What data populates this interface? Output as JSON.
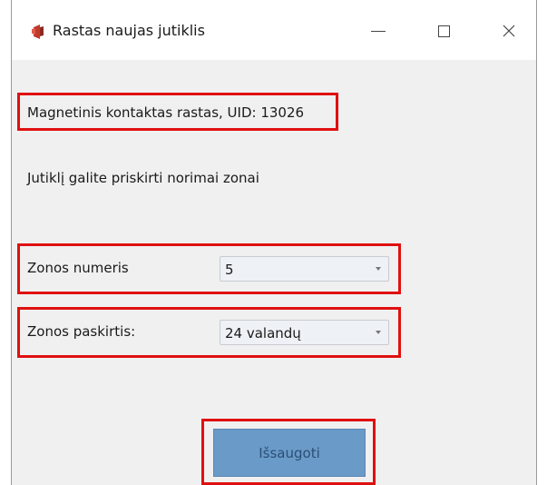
{
  "window": {
    "title": "Rastas naujas jutiklis",
    "controls": {
      "minimize_icon": "minimize-icon",
      "maximize_icon": "maximize-icon",
      "close_icon": "close-icon"
    }
  },
  "main": {
    "found_message": "Magnetinis kontaktas rastas, UID: 13026",
    "instruction": "Jutiklį galite priskirti norimai zonai",
    "zone_number": {
      "label": "Zonos numeris",
      "value": "5"
    },
    "zone_purpose": {
      "label": "Zonos paskirtis:",
      "value": "24 valandų"
    },
    "save_label": "Išsaugoti"
  },
  "colors": {
    "highlight": "#e01010",
    "button": "#6a9ac8",
    "window_bg": "#f0f0f0"
  }
}
